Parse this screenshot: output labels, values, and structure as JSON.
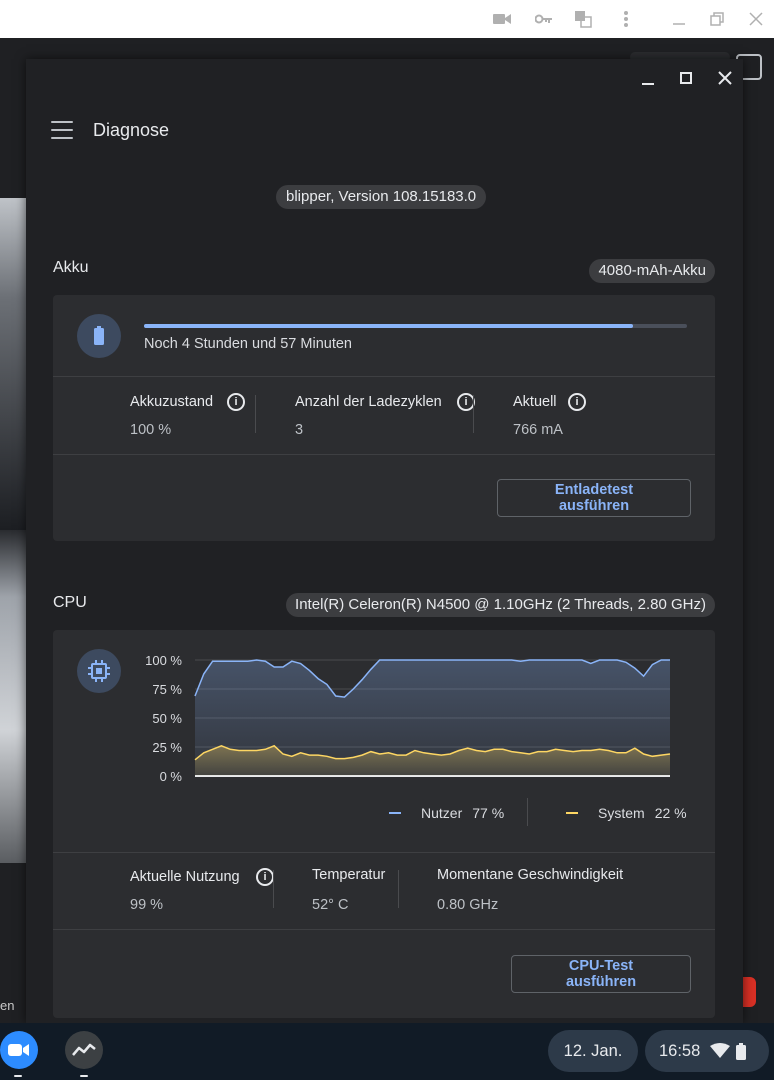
{
  "app": {
    "title": "Diagnose",
    "version": "blipper, Version 108.15183.0"
  },
  "battery": {
    "section_title": "Akku",
    "capacity_badge": "4080-mAh-Akku",
    "charge_fraction": 0.9,
    "remaining_text": "Noch 4 Stunden und 57 Minuten",
    "metrics": [
      {
        "label": "Akkuzustand",
        "value": "100 %"
      },
      {
        "label": "Anzahl der Ladezyklen",
        "value": "3"
      },
      {
        "label": "Aktuell",
        "value": "766 mA"
      }
    ],
    "test_button": "Entladetest ausführen"
  },
  "cpu": {
    "section_title": "CPU",
    "model_badge": "Intel(R) Celeron(R) N4500 @ 1.10GHz (2 Threads, 2.80 GHz)",
    "legend": [
      {
        "name": "Nutzer",
        "value": "77 %",
        "color": "#8ab4f8"
      },
      {
        "name": "System",
        "value": "22 %",
        "color": "#fdd663"
      }
    ],
    "metrics": [
      {
        "label": "Aktuelle Nutzung",
        "value": "99 %"
      },
      {
        "label": "Temperatur",
        "value": "52° C"
      },
      {
        "label": "Momentane Geschwindigkeit",
        "value": "0.80 GHz"
      }
    ],
    "test_button": "CPU-Test ausführen"
  },
  "chart_data": {
    "type": "area",
    "ylim": [
      0,
      100
    ],
    "ytick_labels": [
      "100 %",
      "75 %",
      "50 %",
      "25 %",
      "0 %"
    ],
    "yticks": [
      100,
      75,
      50,
      25,
      0
    ],
    "grid": true,
    "legend_position": "bottom-right",
    "series": [
      {
        "name": "Nutzer",
        "color": "#8ab4f8",
        "values": [
          69,
          88,
          99,
          99,
          99,
          99,
          99,
          100,
          99,
          94,
          94,
          99,
          97,
          91,
          84,
          79,
          69,
          68,
          75,
          83,
          92,
          100,
          100,
          100,
          100,
          100,
          100,
          100,
          100,
          100,
          100,
          100,
          100,
          100,
          100,
          100,
          100,
          99,
          100,
          100,
          100,
          100,
          100,
          100,
          100,
          97,
          100,
          100,
          100,
          98,
          93,
          86,
          96,
          100,
          100
        ]
      },
      {
        "name": "System",
        "color": "#fdd663",
        "values": [
          14,
          20,
          23,
          26,
          23,
          22,
          22,
          22,
          23,
          26,
          19,
          17,
          20,
          18,
          18,
          17,
          15,
          15,
          16,
          18,
          21,
          19,
          20,
          18,
          18,
          22,
          20,
          19,
          18,
          19,
          22,
          24,
          22,
          21,
          23,
          23,
          21,
          20,
          19,
          21,
          21,
          23,
          22,
          21,
          22,
          22,
          23,
          22,
          20,
          20,
          24,
          19,
          17,
          18,
          19
        ]
      }
    ]
  },
  "shelf": {
    "date": "12. Jan.",
    "time": "16:58"
  },
  "background": {
    "partial_text": "en"
  }
}
